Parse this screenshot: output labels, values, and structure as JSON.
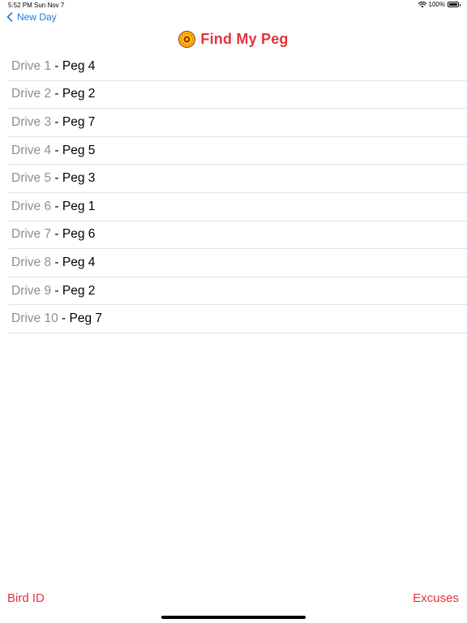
{
  "status_bar": {
    "time": "5:52 PM",
    "date": "Sun Nov 7",
    "battery": "100%",
    "battery_level": 1.0,
    "wifi_icon": "wifi-icon",
    "battery_icon": "battery-icon"
  },
  "nav": {
    "back_label": "New Day",
    "back_icon": "chevron-left-icon",
    "title": "Find My Peg",
    "logo_icon": "logo-icon"
  },
  "list": {
    "separator": " - ",
    "items": [
      {
        "drive": "Drive 1",
        "peg": "Peg 4"
      },
      {
        "drive": "Drive 2",
        "peg": "Peg 2"
      },
      {
        "drive": "Drive 3",
        "peg": "Peg 7"
      },
      {
        "drive": "Drive 4",
        "peg": "Peg 5"
      },
      {
        "drive": "Drive 5",
        "peg": "Peg 3"
      },
      {
        "drive": "Drive 6",
        "peg": "Peg 1"
      },
      {
        "drive": "Drive 7",
        "peg": "Peg 6"
      },
      {
        "drive": "Drive 8",
        "peg": "Peg 4"
      },
      {
        "drive": "Drive 9",
        "peg": "Peg 2"
      },
      {
        "drive": "Drive 10",
        "peg": "Peg 7"
      }
    ]
  },
  "toolbar": {
    "left_label": "Bird ID",
    "right_label": "Excuses"
  },
  "colors": {
    "accent_red": "#e5323c",
    "link_blue": "#1f7ae0",
    "secondary_gray": "#8e8e93",
    "separator": "#e3e3e6",
    "logo_yellow": "#f7c600"
  }
}
